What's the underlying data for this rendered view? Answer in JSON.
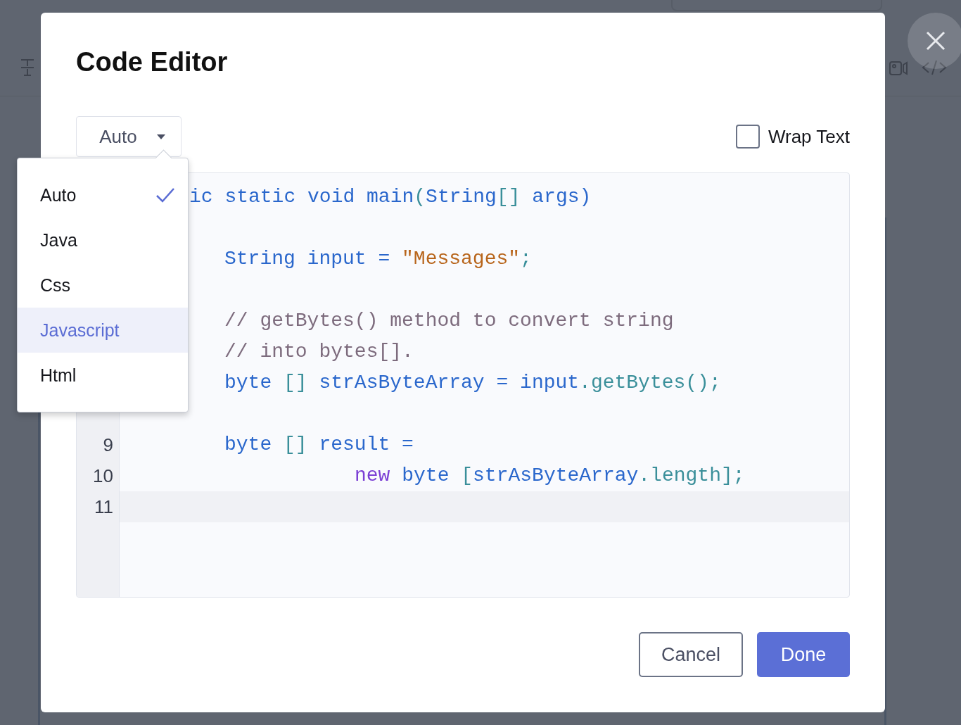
{
  "dialog": {
    "title": "Code Editor"
  },
  "language_select": {
    "value": "Auto",
    "open": true
  },
  "language_menu": [
    {
      "label": "Auto",
      "selected": true,
      "highlighted": false
    },
    {
      "label": "Java",
      "selected": false,
      "highlighted": false
    },
    {
      "label": "Css",
      "selected": false,
      "highlighted": false
    },
    {
      "label": "Javascript",
      "selected": false,
      "highlighted": true
    },
    {
      "label": "Html",
      "selected": false,
      "highlighted": false
    }
  ],
  "wrap_text": {
    "label": "Wrap Text",
    "checked": false
  },
  "code_lines": [
    {
      "kind": "cut",
      "tokens": [
        {
          "kind": "keyword",
          "text": "ic static void main"
        },
        {
          "kind": "punct",
          "text": "("
        },
        {
          "kind": "keyword",
          "text": "String"
        },
        {
          "kind": "punct",
          "text": "[]"
        },
        {
          "kind": "keyword",
          "text": " args)"
        }
      ]
    },
    {
      "kind": "block"
    },
    {
      "kind": "block",
      "tokens": [
        {
          "kind": "keyword",
          "text": "String input = "
        },
        {
          "kind": "string",
          "text": "\"Messages\""
        },
        {
          "kind": "punct",
          "text": ";"
        }
      ]
    },
    {
      "kind": "block"
    },
    {
      "kind": "block",
      "tokens": [
        {
          "kind": "comment",
          "text": "// getBytes() method to convert string"
        }
      ]
    },
    {
      "kind": "block",
      "tokens": [
        {
          "kind": "comment",
          "text": "// into bytes[]."
        }
      ]
    },
    {
      "kind": "block",
      "tokens": [
        {
          "kind": "keyword",
          "text": "byte "
        },
        {
          "kind": "punct",
          "text": "[]"
        },
        {
          "kind": "keyword",
          "text": " strAsByteArray = input"
        },
        {
          "kind": "punct",
          "text": ".getBytes();"
        }
      ]
    },
    {
      "kind": "block"
    },
    {
      "number": "9",
      "kind": "block",
      "tokens": [
        {
          "kind": "keyword",
          "text": "byte "
        },
        {
          "kind": "punct",
          "text": "[]"
        },
        {
          "kind": "keyword",
          "text": " result ="
        }
      ]
    },
    {
      "number": "10",
      "kind": "continuation",
      "tokens": [
        {
          "kind": "new",
          "text": "new"
        },
        {
          "kind": "keyword",
          "text": " byte "
        },
        {
          "kind": "punct",
          "text": "["
        },
        {
          "kind": "keyword",
          "text": "strAsByteArray"
        },
        {
          "kind": "punct",
          "text": ".length];"
        }
      ]
    },
    {
      "number": "11",
      "kind": "block",
      "active": true
    }
  ],
  "buttons": [
    {
      "label": "Cancel",
      "kind": "secondary"
    },
    {
      "label": "Done",
      "kind": "primary"
    }
  ]
}
